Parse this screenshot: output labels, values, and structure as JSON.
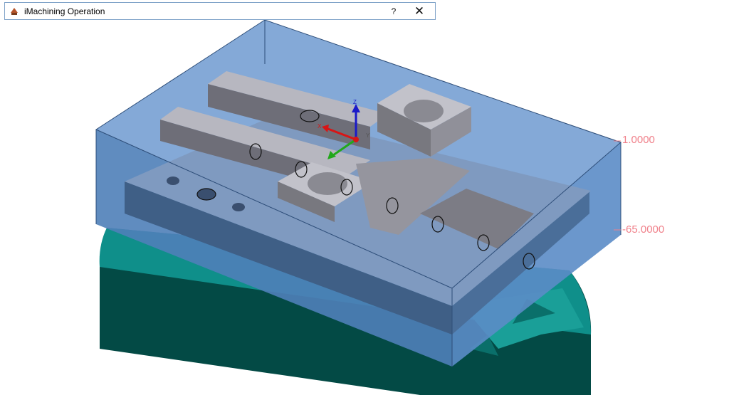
{
  "dialog": {
    "title": "iMachining Operation",
    "help_label": "?",
    "close_label": "✕"
  },
  "viewport": {
    "top_dimension": "1.0000",
    "bottom_dimension": "-65.0000",
    "axis_labels": {
      "x": "X",
      "y": "Y",
      "z": "Z"
    }
  },
  "colors": {
    "stock_fill": "#6f9ad0",
    "part_gray": "#a9a9b3",
    "fixture_teal": "#0f8f8a",
    "fixture_dark": "#034a45",
    "dimension_text": "#f0808a",
    "axis_x": "#d81515",
    "axis_y": "#22a81a",
    "axis_z": "#1a1ac8"
  },
  "icons": [
    "app-icon",
    "help-icon",
    "close-icon"
  ]
}
